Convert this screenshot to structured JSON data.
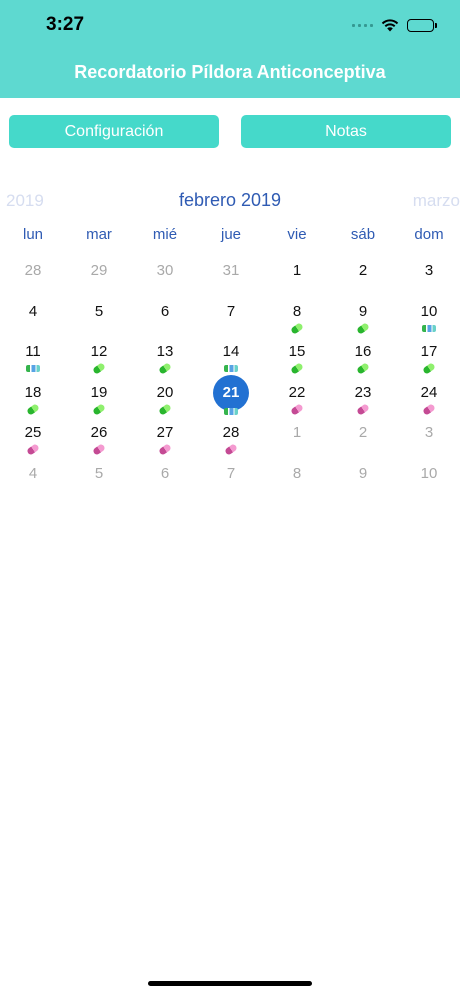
{
  "status": {
    "time": "3:27"
  },
  "header": {
    "title": "Recordatorio Píldora Anticonceptiva"
  },
  "buttons": {
    "config": "Configuración",
    "notes": "Notas"
  },
  "calendar": {
    "prev_label": "2019",
    "current_label": "febrero 2019",
    "next_label": "marzo",
    "weekdays": [
      "lun",
      "mar",
      "mié",
      "jue",
      "vie",
      "sáb",
      "dom"
    ],
    "weeks": [
      [
        {
          "d": "28",
          "muted": true
        },
        {
          "d": "29",
          "muted": true
        },
        {
          "d": "30",
          "muted": true
        },
        {
          "d": "31",
          "muted": true
        },
        {
          "d": "1"
        },
        {
          "d": "2"
        },
        {
          "d": "3"
        }
      ],
      [
        {
          "d": "4"
        },
        {
          "d": "5"
        },
        {
          "d": "6"
        },
        {
          "d": "7"
        },
        {
          "d": "8",
          "pill": "green"
        },
        {
          "d": "9",
          "pill": "green"
        },
        {
          "d": "10",
          "pill": "mix"
        }
      ],
      [
        {
          "d": "11",
          "pill": "mix"
        },
        {
          "d": "12",
          "pill": "green"
        },
        {
          "d": "13",
          "pill": "green"
        },
        {
          "d": "14",
          "pill": "mix"
        },
        {
          "d": "15",
          "pill": "green"
        },
        {
          "d": "16",
          "pill": "green"
        },
        {
          "d": "17",
          "pill": "green"
        }
      ],
      [
        {
          "d": "18",
          "pill": "green"
        },
        {
          "d": "19",
          "pill": "green"
        },
        {
          "d": "20",
          "pill": "green"
        },
        {
          "d": "21",
          "pill": "mix",
          "selected": true
        },
        {
          "d": "22",
          "pill": "pink"
        },
        {
          "d": "23",
          "pill": "pink"
        },
        {
          "d": "24",
          "pill": "pink"
        }
      ],
      [
        {
          "d": "25",
          "pill": "pink"
        },
        {
          "d": "26",
          "pill": "pink"
        },
        {
          "d": "27",
          "pill": "pink"
        },
        {
          "d": "28",
          "pill": "pink"
        },
        {
          "d": "1",
          "muted": true
        },
        {
          "d": "2",
          "muted": true
        },
        {
          "d": "3",
          "muted": true
        }
      ],
      [
        {
          "d": "4",
          "muted": true
        },
        {
          "d": "5",
          "muted": true
        },
        {
          "d": "6",
          "muted": true
        },
        {
          "d": "7",
          "muted": true
        },
        {
          "d": "8",
          "muted": true
        },
        {
          "d": "9",
          "muted": true
        },
        {
          "d": "10",
          "muted": true
        }
      ]
    ]
  },
  "colors": {
    "header": "#5ed9d0",
    "button": "#45d9ca",
    "accent": "#2f5bb3",
    "selected": "#2271d2"
  },
  "icons": {
    "wifi": "wifi-icon",
    "battery": "battery-icon",
    "pill": "pill-icon"
  }
}
